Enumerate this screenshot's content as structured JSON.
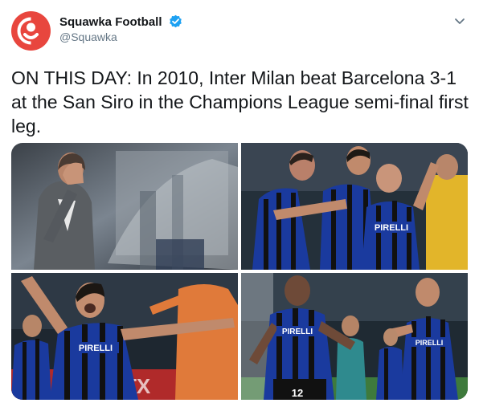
{
  "tweet": {
    "author_name": "Squawka Football",
    "handle": "@Squawka",
    "text": "ON THIS DAY: In 2010, Inter Milan beat Barcelona 3-1 at the San Siro in the Champions League semi-final first leg."
  },
  "colors": {
    "brand_red": "#e8463e",
    "verified_blue": "#1da1f2",
    "inter_blue": "#1a3a9e"
  },
  "icons": [
    "squawka-logo-icon",
    "verified-badge-icon",
    "chevron-down-icon"
  ],
  "photos": [
    {
      "subject": "manager-head-in-hands-photo"
    },
    {
      "subject": "inter-players-celebrating-photo"
    },
    {
      "subject": "inter-striker-celebrating-photo"
    },
    {
      "subject": "inter-players-running-celebrating-photo"
    }
  ],
  "photo_text": {
    "sponsor_a": "PIRELLI",
    "sponsor_b": "PIRELLI",
    "sponsor_c": "PIRELLI",
    "sponsor_d": "PIRELLI",
    "shirt_number": "12",
    "board_text": "TX"
  }
}
